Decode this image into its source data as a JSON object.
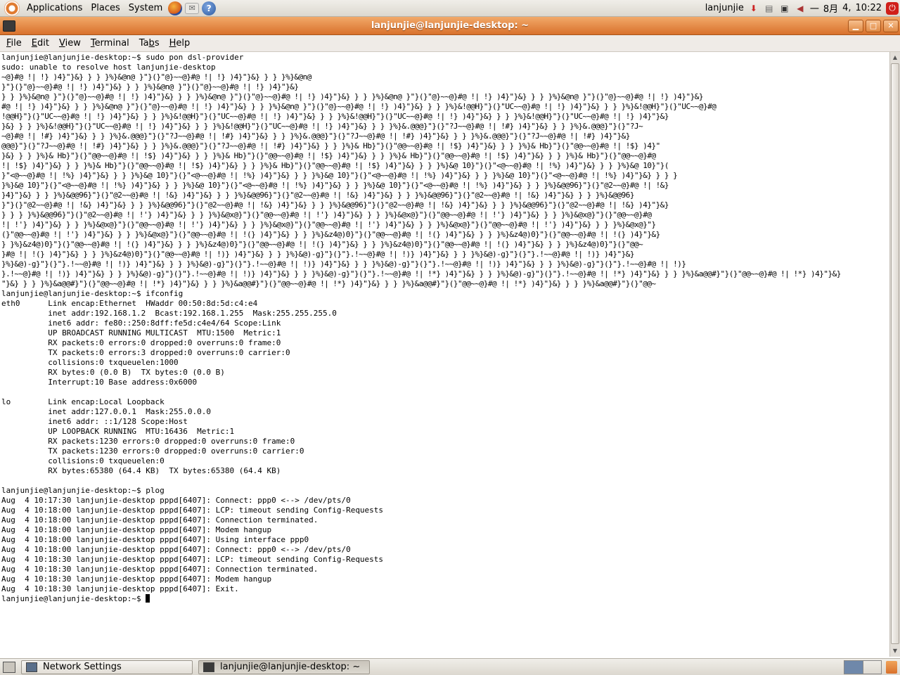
{
  "top_panel": {
    "menus": [
      "Applications",
      "Places",
      "System"
    ],
    "user": "lanjunjie",
    "keyboard": "一",
    "month": "8月",
    "day": "4,",
    "time": "10:22"
  },
  "window": {
    "title": "lanjunjie@lanjunjie-desktop: ~"
  },
  "menubar": {
    "items": [
      {
        "label": "File",
        "mnemonic": "F"
      },
      {
        "label": "Edit",
        "mnemonic": "E"
      },
      {
        "label": "View",
        "mnemonic": "V"
      },
      {
        "label": "Terminal",
        "mnemonic": "T"
      },
      {
        "label": "Tabs",
        "mnemonic": "b"
      },
      {
        "label": "Help",
        "mnemonic": "H"
      }
    ]
  },
  "terminal": {
    "before_garbage": [
      "lanjunjie@lanjunjie-desktop:~$ sudo pon dsl-provider",
      "sudo: unable to resolve host lanjunjie-desktop"
    ],
    "garbage_lines": [
      "~@}#@ !| !} )4}\"}&} } } }%}&@n@ }\"}(}\"@}~~@}#@ !| !} )4}\"}&} } } }%}&@n@",
      "}\"}(}\"@}~~@}#@ !| !} )4}\"}&} } } }%}&@n@ }\"}(}\"@}~~@}#@ !| !} )4}\"}&}",
      "} } }%}&@n@ }\"}(}\"@}~~@}#@ !| !} )4}\"}&} } } }%}&@n@ }\"}(}\"@}~~@}#@ !| !} )4}\"}&} } } }%}&@n@ }\"}(}\"@}~~@}#@ !| !} )4}\"}&} } } }%}&@n@ }\"}(}\"@}~~@}#@ !| !} )4}\"}&}",
      "#@ !| !} )4}\"}&} } } }%}&@n@ }\"}(}\"@}~~@}#@ !| !} )4}\"}&} } } }%}&@n@ }\"}(}\"@}~~@}#@ !| !} )4}\"}&} } } }%}&!@@H}\"}(}\"UC~~@}#@ !| !} )4}\"}&} } } }%}&!@@H}\"}(}\"UC~~@}#@",
      "!@@H}\"}(}\"UC~~@}#@ !| !} )4}\"}&} } } }%}&!@@H}\"}(}\"UC~~@}#@ !| !} )4}\"}&} } } }%}&!@@H}\"}(}\"UC~~@}#@ !| !} )4}\"}&} } } }%}&!@@H}\"}(}\"UC~~@}#@ !| !} )4}\"}&}",
      "}&} } } }%}&!@@H}\"}(}\"UC~~@}#@ !| !} )4}\"}&} } } }%}&!@@H}\"}(}\"UC~~@}#@ !| !} )4}\"}&} } } }%}&.@@@}\"}(}\"?J~~@}#@ !| !#} )4}\"}&} } } }%}&.@@@}\"}(}\"?J~",
      "~@}#@ !| !#} )4}\"}&} } } }%}&.@@@}\"}(}\"?J~~@}#@ !| !#} )4}\"}&} } } }%}&.@@@}\"}(}\"?J~~@}#@ !| !#} )4}\"}&} } } }%}&.@@@}\"}(}\"?J~~@}#@ !| !#} )4}\"}&}",
      "@@@}\"}(}\"?J~~@}#@ !| !#} )4}\"}&} } } }%}&.@@@}\"}(}\"?J~~@}#@ !| !#} )4}\"}&} } } }%}& Hb}\"}(}\"@@~~@}#@ !| !$} )4}\"}&} } } }%}& Hb}\"}(}\"@@~~@}#@ !| !$} )4}\"",
      "}&} } } }%}& Hb}\"}(}\"@@~~@}#@ !| !$} )4}\"}&} } } }%}& Hb}\"}(}\"@@~~@}#@ !| !$} )4}\"}&} } } }%}& Hb}\"}(}\"@@~~@}#@ !| !$} )4}\"}&} } } }%}& Hb}\"}(}\"@@~~@}#@",
      "!| !$} )4}\"}&} } } }%}& Hb}\"}(}\"@@~~@}#@ !| !$} )4}\"}&} } } }%}& Hb}\"}(}\"@@~~@}#@ !| !$} )4}\"}&} } } }%}&@ 10}\"}(}\"<@~~@}#@ !| !%} )4}\"}&} } } }%}&@ 10}\"}(",
      "}\"<@~~@}#@ !| !%} )4}\"}&} } } }%}&@ 10}\"}(}\"<@~~@}#@ !| !%} )4}\"}&} } } }%}&@ 10}\"}(}\"<@~~@}#@ !| !%} )4}\"}&} } } }%}&@ 10}\"}(}\"<@~~@}#@ !| !%} )4}\"}&} } } }",
      "}%}&@ 10}\"}(}\"<@~~@}#@ !| !%} )4}\"}&} } } }%}&@ 10}\"}(}\"<@~~@}#@ !| !%} )4}\"}&} } } }%}&@ 10}\"}(}\"<@~~@}#@ !| !%} )4}\"}&} } } }%}&@@96}\"}(}\"@2~~@}#@ !| !&}",
      "}4}\"}&} } } }%}&@@96}\"}(}\"@2~~@}#@ !| !&} )4}\"}&} } } }%}&@@96}\"}(}\"@2~~@}#@ !| !&} )4}\"}&} } } }%}&@@96}\"}(}\"@2~~@}#@ !| !&} )4}\"}&} } } }%}&@@96}",
      "}\"}(}\"@2~~@}#@ !| !&} )4}\"}&} } } }%}&@@96}\"}(}\"@2~~@}#@ !| !&} )4}\"}&} } } }%}&@@96}\"}(}\"@2~~@}#@ !| !&} )4}\"}&} } } }%}&@@96}\"}(}\"@2~~@}#@ !| !&} )4}\"}&}",
      "} } } }%}&@@96}\"}(}\"@2~~@}#@ !| !'} )4}\"}&} } } }%}&@x@}\"}(}\"@@~~@}#@ !| !'} )4}\"}&} } } }%}&@x@}\"}(}\"@@~~@}#@ !| !'} )4}\"}&} } } }%}&@x@}\"}(}\"@@~~@}#@",
      "!| !'} )4}\"}&} } } }%}&@x@}\"}(}\"@@~~@}#@ !| !'} )4}\"}&} } } }%}&@x@}\"}(}\"@@~~@}#@ !| !'} )4}\"}&} } } }%}&@x@}\"}(}\"@@~~@}#@ !| !'} )4}\"}&} } } }%}&@x@}\"}",
      "(}\"@@~~@}#@ !| !'} )4}\"}&} } } }%}&@x@}\"}(}\"@@~~@}#@ !| !(} )4}\"}&} } } }%}&z4@)0}\"}(}\"@@~~@}#@ !| !(} )4}\"}&} } } }%}&z4@)0}\"}(}\"@@~~@}#@ !| !(} )4}\"}&}",
      "} }%}&z4@)0}\"}(}\"@@~~@}#@ !| !(} )4}\"}&} } } }%}&z4@)0}\"}(}\"@@~~@}#@ !| !(} )4}\"}&} } } }%}&z4@)0}\"}(}\"@@~~@}#@ !| !(} )4}\"}&} } } }%}&z4@)0}\"}(}\"@@~",
      "}#@ !| !(} )4}\"}&} } } }%}&z4@)0}\"}(}\"@@~~@}#@ !| !)} )4}\"}&} } } }%}&@)-g}\"}(}\"}.!~~@}#@ !| !)} )4}\"}&} } } }%}&@)-g}\"}(}\"}.!~~@}#@ !| !)} )4}\"}&}",
      "}%}&@)-g}\"}(}\"}.!~~@}#@ !| !)} )4}\"}&} } } }%}&@)-g}\"}(}\"}.!~~@}#@ !| !)} )4}\"}&} } } }%}&@)-g}\"}(}\"}.!~~@}#@ !| !)} )4}\"}&} } } }%}&@)-g}\"}(}\"}.!~~@}#@ !| !)}",
      "}.!~~@}#@ !| !)} )4}\"}&} } } }%}&@)-g}\"}(}\"}.!~~@}#@ !| !)} )4}\"}&} } } }%}&@)-g}\"}(}\"}.!~~@}#@ !| !*} )4}\"}&} } } }%}&@)-g}\"}(}\"}.!~~@}#@ !| !*} )4}\"}&} } } }%}&a@@#}\"}(}\"@@~~@}#@ !| !*} )4}\"}&}",
      "\"}&} } } }%}&a@@#}\"}(}\"@@~~@}#@ !| !*} )4}\"}&} } } }%}&a@@#}\"}(}\"@@~~@}#@ !| !*} )4}\"}&} } } }%}&a@@#}\"}(}\"@@~~@}#@ !| !*} )4}\"}&} } } }%}&a@@#}\"}(}\"@@~"
    ],
    "after_garbage": [
      "lanjunjie@lanjunjie-desktop:~$ ifconfig",
      "eth0      Link encap:Ethernet  HWaddr 00:50:8d:5d:c4:e4",
      "          inet addr:192.168.1.2  Bcast:192.168.1.255  Mask:255.255.255.0",
      "          inet6 addr: fe80::250:8dff:fe5d:c4e4/64 Scope:Link",
      "          UP BROADCAST RUNNING MULTICAST  MTU:1500  Metric:1",
      "          RX packets:0 errors:0 dropped:0 overruns:0 frame:0",
      "          TX packets:0 errors:3 dropped:0 overruns:0 carrier:0",
      "          collisions:0 txqueuelen:1000",
      "          RX bytes:0 (0.0 B)  TX bytes:0 (0.0 B)",
      "          Interrupt:10 Base address:0x6000",
      "",
      "lo        Link encap:Local Loopback",
      "          inet addr:127.0.0.1  Mask:255.0.0.0",
      "          inet6 addr: ::1/128 Scope:Host",
      "          UP LOOPBACK RUNNING  MTU:16436  Metric:1",
      "          RX packets:1230 errors:0 dropped:0 overruns:0 frame:0",
      "          TX packets:1230 errors:0 dropped:0 overruns:0 carrier:0",
      "          collisions:0 txqueuelen:0",
      "          RX bytes:65380 (64.4 KB)  TX bytes:65380 (64.4 KB)",
      "",
      "lanjunjie@lanjunjie-desktop:~$ plog",
      "Aug  4 10:17:30 lanjunjie-desktop pppd[6407]: Connect: ppp0 <--> /dev/pts/0",
      "Aug  4 10:18:00 lanjunjie-desktop pppd[6407]: LCP: timeout sending Config-Requests",
      "Aug  4 10:18:00 lanjunjie-desktop pppd[6407]: Connection terminated.",
      "Aug  4 10:18:00 lanjunjie-desktop pppd[6407]: Modem hangup",
      "Aug  4 10:18:00 lanjunjie-desktop pppd[6407]: Using interface ppp0",
      "Aug  4 10:18:00 lanjunjie-desktop pppd[6407]: Connect: ppp0 <--> /dev/pts/0",
      "Aug  4 10:18:30 lanjunjie-desktop pppd[6407]: LCP: timeout sending Config-Requests",
      "Aug  4 10:18:30 lanjunjie-desktop pppd[6407]: Connection terminated.",
      "Aug  4 10:18:30 lanjunjie-desktop pppd[6407]: Modem hangup",
      "Aug  4 10:18:30 lanjunjie-desktop pppd[6407]: Exit."
    ],
    "prompt": "lanjunjie@lanjunjie-desktop:~$ "
  },
  "taskbar": {
    "tasks": [
      {
        "label": "Network Settings",
        "icon": "network-settings-icon",
        "active": false
      },
      {
        "label": "lanjunjie@lanjunjie-desktop: ~",
        "icon": "terminal-icon",
        "active": true
      }
    ]
  },
  "icons": {
    "logo": "ubuntu-logo-icon",
    "launchers": [
      "firefox-icon",
      "mail-icon",
      "help-icon"
    ],
    "tray": [
      "update-notifier-icon",
      "printer-icon",
      "network-icon",
      "volume-icon",
      "power-icon"
    ]
  },
  "colors": {
    "title_bar": "#d9712c",
    "panel": "#e6e2da",
    "terminal_bg": "#ffffff",
    "terminal_fg": "#000000"
  }
}
